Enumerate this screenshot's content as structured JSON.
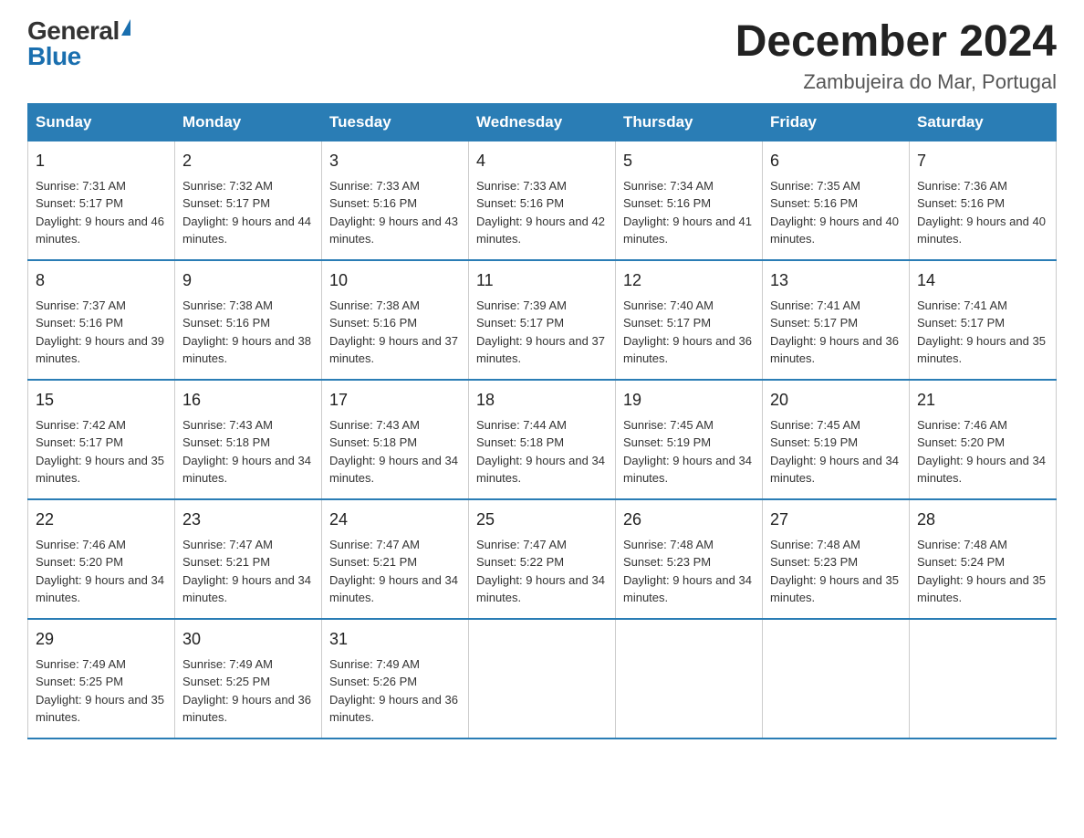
{
  "logo": {
    "general": "General",
    "blue": "Blue"
  },
  "title": "December 2024",
  "subtitle": "Zambujeira do Mar, Portugal",
  "days_of_week": [
    "Sunday",
    "Monday",
    "Tuesday",
    "Wednesday",
    "Thursday",
    "Friday",
    "Saturday"
  ],
  "weeks": [
    [
      {
        "day": "1",
        "sunrise": "7:31 AM",
        "sunset": "5:17 PM",
        "daylight": "9 hours and 46 minutes."
      },
      {
        "day": "2",
        "sunrise": "7:32 AM",
        "sunset": "5:17 PM",
        "daylight": "9 hours and 44 minutes."
      },
      {
        "day": "3",
        "sunrise": "7:33 AM",
        "sunset": "5:16 PM",
        "daylight": "9 hours and 43 minutes."
      },
      {
        "day": "4",
        "sunrise": "7:33 AM",
        "sunset": "5:16 PM",
        "daylight": "9 hours and 42 minutes."
      },
      {
        "day": "5",
        "sunrise": "7:34 AM",
        "sunset": "5:16 PM",
        "daylight": "9 hours and 41 minutes."
      },
      {
        "day": "6",
        "sunrise": "7:35 AM",
        "sunset": "5:16 PM",
        "daylight": "9 hours and 40 minutes."
      },
      {
        "day": "7",
        "sunrise": "7:36 AM",
        "sunset": "5:16 PM",
        "daylight": "9 hours and 40 minutes."
      }
    ],
    [
      {
        "day": "8",
        "sunrise": "7:37 AM",
        "sunset": "5:16 PM",
        "daylight": "9 hours and 39 minutes."
      },
      {
        "day": "9",
        "sunrise": "7:38 AM",
        "sunset": "5:16 PM",
        "daylight": "9 hours and 38 minutes."
      },
      {
        "day": "10",
        "sunrise": "7:38 AM",
        "sunset": "5:16 PM",
        "daylight": "9 hours and 37 minutes."
      },
      {
        "day": "11",
        "sunrise": "7:39 AM",
        "sunset": "5:17 PM",
        "daylight": "9 hours and 37 minutes."
      },
      {
        "day": "12",
        "sunrise": "7:40 AM",
        "sunset": "5:17 PM",
        "daylight": "9 hours and 36 minutes."
      },
      {
        "day": "13",
        "sunrise": "7:41 AM",
        "sunset": "5:17 PM",
        "daylight": "9 hours and 36 minutes."
      },
      {
        "day": "14",
        "sunrise": "7:41 AM",
        "sunset": "5:17 PM",
        "daylight": "9 hours and 35 minutes."
      }
    ],
    [
      {
        "day": "15",
        "sunrise": "7:42 AM",
        "sunset": "5:17 PM",
        "daylight": "9 hours and 35 minutes."
      },
      {
        "day": "16",
        "sunrise": "7:43 AM",
        "sunset": "5:18 PM",
        "daylight": "9 hours and 34 minutes."
      },
      {
        "day": "17",
        "sunrise": "7:43 AM",
        "sunset": "5:18 PM",
        "daylight": "9 hours and 34 minutes."
      },
      {
        "day": "18",
        "sunrise": "7:44 AM",
        "sunset": "5:18 PM",
        "daylight": "9 hours and 34 minutes."
      },
      {
        "day": "19",
        "sunrise": "7:45 AM",
        "sunset": "5:19 PM",
        "daylight": "9 hours and 34 minutes."
      },
      {
        "day": "20",
        "sunrise": "7:45 AM",
        "sunset": "5:19 PM",
        "daylight": "9 hours and 34 minutes."
      },
      {
        "day": "21",
        "sunrise": "7:46 AM",
        "sunset": "5:20 PM",
        "daylight": "9 hours and 34 minutes."
      }
    ],
    [
      {
        "day": "22",
        "sunrise": "7:46 AM",
        "sunset": "5:20 PM",
        "daylight": "9 hours and 34 minutes."
      },
      {
        "day": "23",
        "sunrise": "7:47 AM",
        "sunset": "5:21 PM",
        "daylight": "9 hours and 34 minutes."
      },
      {
        "day": "24",
        "sunrise": "7:47 AM",
        "sunset": "5:21 PM",
        "daylight": "9 hours and 34 minutes."
      },
      {
        "day": "25",
        "sunrise": "7:47 AM",
        "sunset": "5:22 PM",
        "daylight": "9 hours and 34 minutes."
      },
      {
        "day": "26",
        "sunrise": "7:48 AM",
        "sunset": "5:23 PM",
        "daylight": "9 hours and 34 minutes."
      },
      {
        "day": "27",
        "sunrise": "7:48 AM",
        "sunset": "5:23 PM",
        "daylight": "9 hours and 35 minutes."
      },
      {
        "day": "28",
        "sunrise": "7:48 AM",
        "sunset": "5:24 PM",
        "daylight": "9 hours and 35 minutes."
      }
    ],
    [
      {
        "day": "29",
        "sunrise": "7:49 AM",
        "sunset": "5:25 PM",
        "daylight": "9 hours and 35 minutes."
      },
      {
        "day": "30",
        "sunrise": "7:49 AM",
        "sunset": "5:25 PM",
        "daylight": "9 hours and 36 minutes."
      },
      {
        "day": "31",
        "sunrise": "7:49 AM",
        "sunset": "5:26 PM",
        "daylight": "9 hours and 36 minutes."
      },
      null,
      null,
      null,
      null
    ]
  ]
}
